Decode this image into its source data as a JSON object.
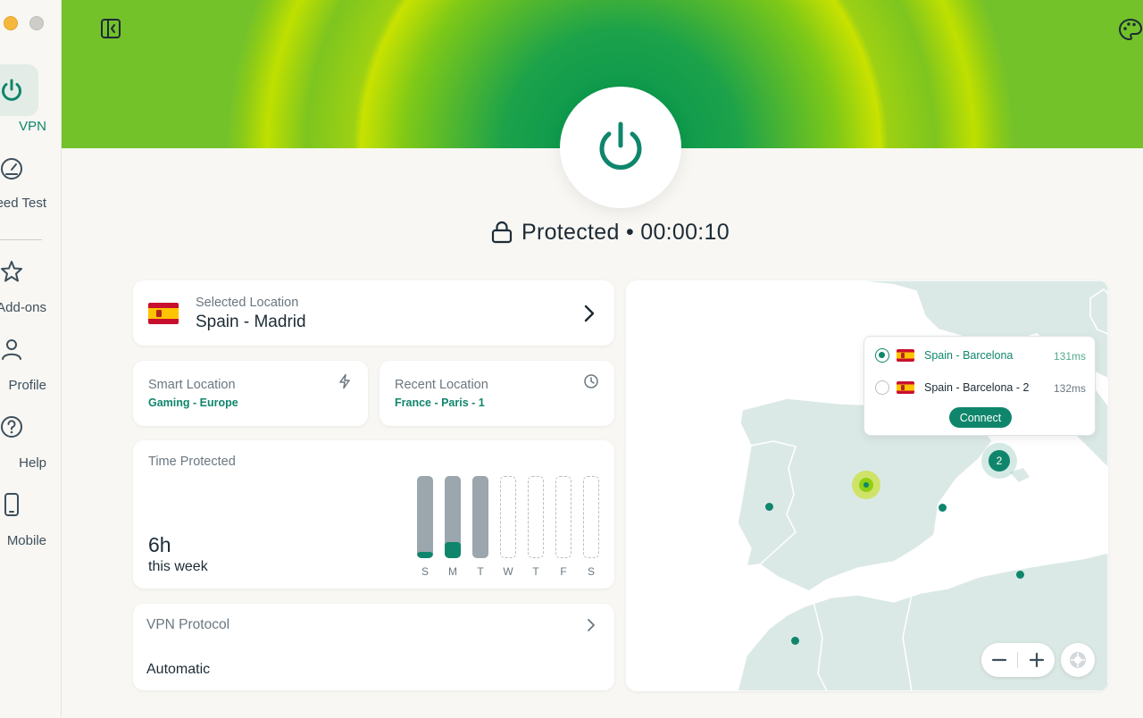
{
  "sidebar": {
    "items": [
      {
        "label": "VPN"
      },
      {
        "label": "Speed Test"
      },
      {
        "label": "Add-ons"
      },
      {
        "label": "Profile"
      },
      {
        "label": "Help"
      },
      {
        "label": "Mobile"
      }
    ]
  },
  "status": {
    "text": "Protected • 00:00:10"
  },
  "selected_location": {
    "caption": "Selected Location",
    "value": "Spain - Madrid"
  },
  "smart_location": {
    "caption": "Smart Location",
    "value": "Gaming - Europe"
  },
  "recent_location": {
    "caption": "Recent Location",
    "value": "France - Paris - 1"
  },
  "time_protected": {
    "caption": "Time Protected",
    "total": "6h",
    "period": "this week",
    "days": [
      {
        "label": "S",
        "state": "past",
        "level": 0.08
      },
      {
        "label": "M",
        "state": "past",
        "level": 0.2
      },
      {
        "label": "T",
        "state": "past",
        "level": 0
      },
      {
        "label": "W",
        "state": "future",
        "level": 0
      },
      {
        "label": "T",
        "state": "future",
        "level": 0
      },
      {
        "label": "F",
        "state": "future",
        "level": 0
      },
      {
        "label": "S",
        "state": "future",
        "level": 0
      }
    ]
  },
  "protocol": {
    "caption": "VPN Protocol",
    "value": "Automatic"
  },
  "map": {
    "cluster_count": "2",
    "popup": {
      "options": [
        {
          "name": "Spain - Barcelona",
          "latency": "131ms",
          "selected": true
        },
        {
          "name": "Spain - Barcelona - 2",
          "latency": "132ms",
          "selected": false
        }
      ],
      "connect_label": "Connect"
    }
  },
  "colors": {
    "accent": "#0f866c",
    "hero_green": "#00924f",
    "hero_lime": "#c9e200",
    "background": "#f8f7f3"
  },
  "icons": {
    "sidebar_toggle": "sidebar-toggle-icon",
    "theme": "palette-icon",
    "power": "power-icon",
    "lock": "lock-icon"
  }
}
